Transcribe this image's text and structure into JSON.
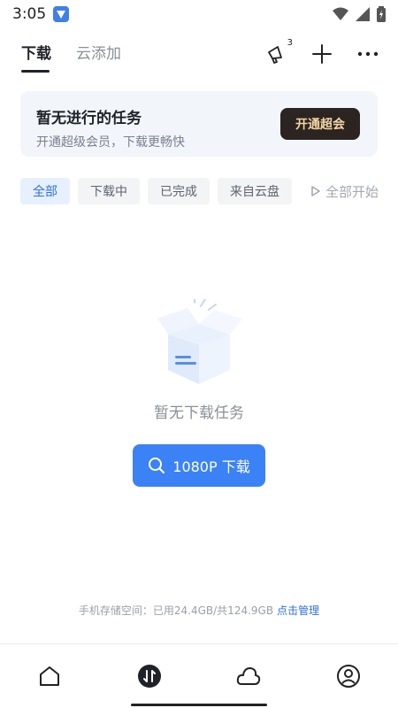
{
  "status_bar": {
    "time": "3:05"
  },
  "top_tabs": [
    {
      "label": "下载",
      "active": true
    },
    {
      "label": "云添加",
      "active": false
    }
  ],
  "top_actions": {
    "notification_count": "3"
  },
  "vip_banner": {
    "title": "暂无进行的任务",
    "subtitle": "开通超级会员，下载更畅快",
    "button_label": "开通超会"
  },
  "filters": [
    {
      "label": "全部",
      "active": true
    },
    {
      "label": "下载中",
      "active": false
    },
    {
      "label": "已完成",
      "active": false
    },
    {
      "label": "来自云盘",
      "active": false
    }
  ],
  "start_all_label": "全部开始",
  "empty_state": {
    "message": "暂无下载任务",
    "button_label": "1080P 下载"
  },
  "storage": {
    "text": "手机存储空间：已用24.4GB/共124.9GB",
    "link_label": "点击管理"
  },
  "bottom_nav": [
    {
      "name": "home-icon"
    },
    {
      "name": "transfer-icon"
    },
    {
      "name": "cloud-icon"
    },
    {
      "name": "profile-icon"
    }
  ],
  "colors": {
    "accent": "#3b82f6",
    "vip_button_bg": "#2b2420",
    "vip_button_text": "#f3d5a5"
  }
}
